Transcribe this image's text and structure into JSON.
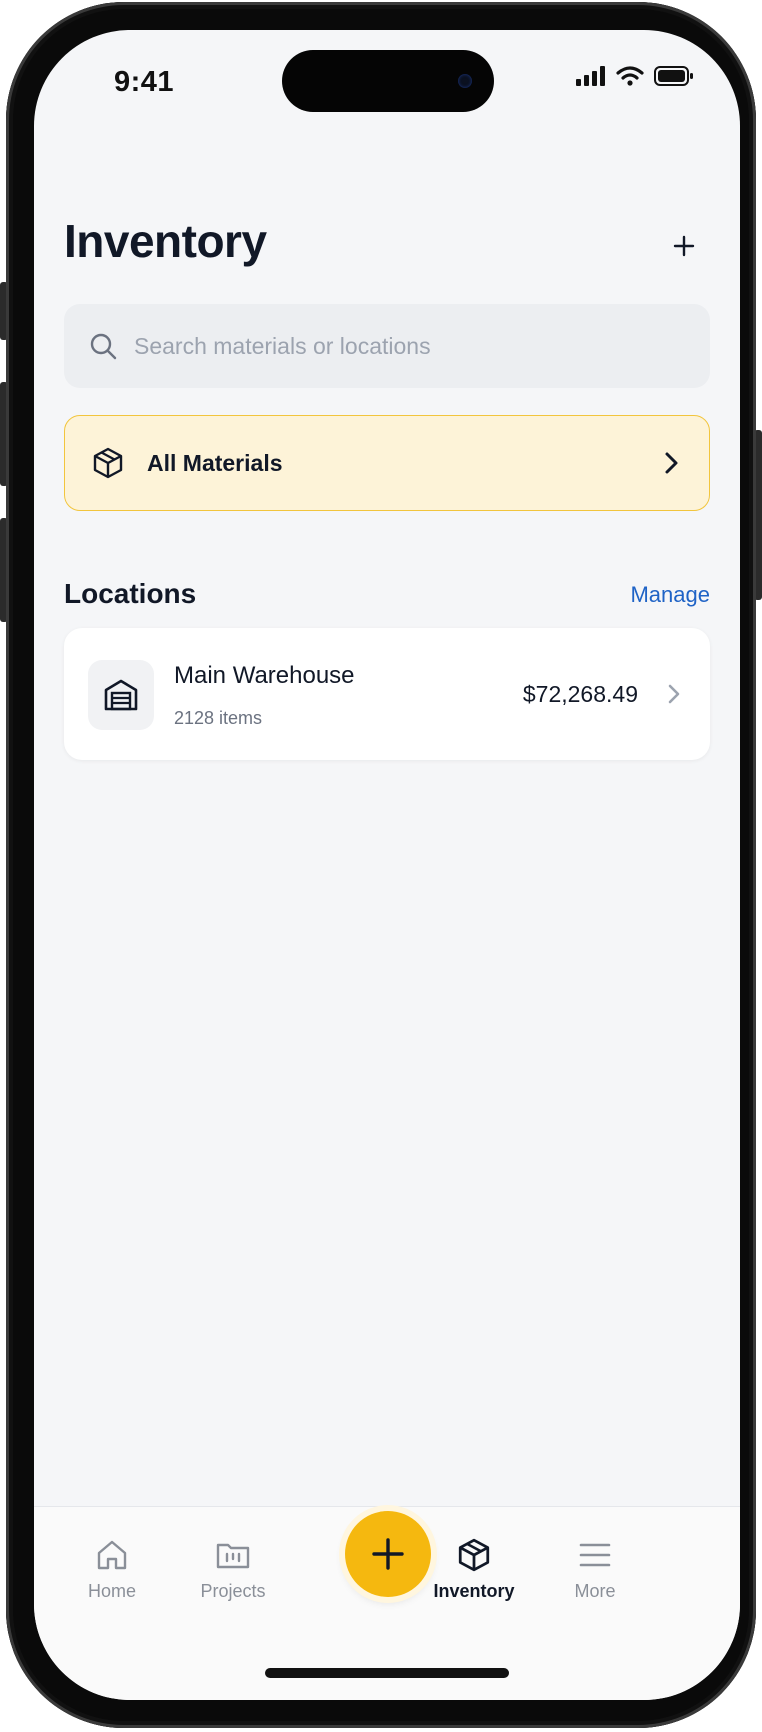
{
  "status": {
    "time": "9:41",
    "icons": [
      "signal-icon",
      "wifi-icon",
      "battery-icon"
    ]
  },
  "header": {
    "title": "Inventory",
    "add_icon": "plus-icon"
  },
  "search": {
    "placeholder": "Search materials or locations",
    "icon": "search-icon"
  },
  "all_materials": {
    "label": "All Materials",
    "icon": "box-icon"
  },
  "locations": {
    "title": "Locations",
    "manage_label": "Manage",
    "items": [
      {
        "name": "Main Warehouse",
        "count": "2128 items",
        "value": "$72,268.49",
        "icon": "warehouse-icon"
      }
    ]
  },
  "tabbar": {
    "tabs": [
      {
        "label": "Home",
        "icon": "home-icon"
      },
      {
        "label": "Projects",
        "icon": "folder-icon"
      },
      {
        "label": "Inventory",
        "icon": "box-icon",
        "active": true
      },
      {
        "label": "More",
        "icon": "menu-icon"
      }
    ],
    "fab_icon": "plus-icon"
  },
  "colors": {
    "accent": "#f5b80f",
    "highlight_bg": "#fdf3d8",
    "link": "#1f63c6",
    "background": "#f5f6f8"
  }
}
